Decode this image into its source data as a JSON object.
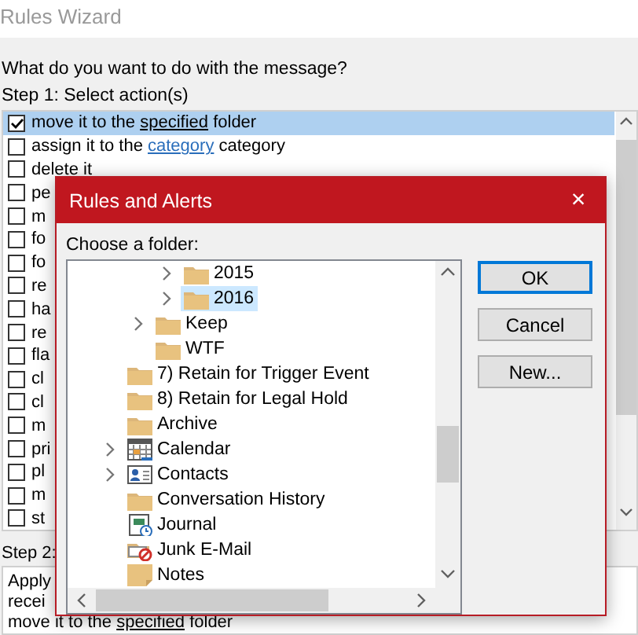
{
  "window": {
    "title": "Rules Wizard"
  },
  "question": "What do you want to do with the message?",
  "step1": {
    "label": "Step 1: Select action(s)",
    "actions": [
      {
        "checked": true,
        "selected": true,
        "parts": [
          {
            "kind": "text",
            "text": "move it to the "
          },
          {
            "kind": "link_set",
            "text": "specified"
          },
          {
            "kind": "text",
            "text": " folder"
          }
        ]
      },
      {
        "checked": false,
        "selected": false,
        "parts": [
          {
            "kind": "text",
            "text": "assign it to the "
          },
          {
            "kind": "link_unset",
            "text": "category"
          },
          {
            "kind": "text",
            "text": " category"
          }
        ]
      },
      {
        "checked": false,
        "selected": false,
        "parts": [
          {
            "kind": "text",
            "text": "delete it"
          }
        ]
      },
      {
        "checked": false,
        "selected": false,
        "parts": [
          {
            "kind": "text",
            "text": "pe"
          }
        ]
      },
      {
        "checked": false,
        "selected": false,
        "parts": [
          {
            "kind": "text",
            "text": "m"
          }
        ]
      },
      {
        "checked": false,
        "selected": false,
        "parts": [
          {
            "kind": "text",
            "text": "fo"
          }
        ]
      },
      {
        "checked": false,
        "selected": false,
        "parts": [
          {
            "kind": "text",
            "text": "fo"
          }
        ]
      },
      {
        "checked": false,
        "selected": false,
        "parts": [
          {
            "kind": "text",
            "text": "re"
          }
        ]
      },
      {
        "checked": false,
        "selected": false,
        "parts": [
          {
            "kind": "text",
            "text": "ha"
          }
        ]
      },
      {
        "checked": false,
        "selected": false,
        "parts": [
          {
            "kind": "text",
            "text": "re"
          }
        ]
      },
      {
        "checked": false,
        "selected": false,
        "parts": [
          {
            "kind": "text",
            "text": "fla"
          }
        ]
      },
      {
        "checked": false,
        "selected": false,
        "parts": [
          {
            "kind": "text",
            "text": "cl"
          }
        ]
      },
      {
        "checked": false,
        "selected": false,
        "parts": [
          {
            "kind": "text",
            "text": "cl"
          }
        ]
      },
      {
        "checked": false,
        "selected": false,
        "parts": [
          {
            "kind": "text",
            "text": "m"
          }
        ]
      },
      {
        "checked": false,
        "selected": false,
        "parts": [
          {
            "kind": "text",
            "text": "pri"
          }
        ]
      },
      {
        "checked": false,
        "selected": false,
        "parts": [
          {
            "kind": "text",
            "text": "pl"
          }
        ]
      },
      {
        "checked": false,
        "selected": false,
        "parts": [
          {
            "kind": "text",
            "text": "m"
          }
        ]
      },
      {
        "checked": false,
        "selected": false,
        "parts": [
          {
            "kind": "text",
            "text": "st"
          }
        ]
      }
    ]
  },
  "step2": {
    "label": "Step 2:",
    "lines": [
      [
        {
          "kind": "text",
          "text": "Apply"
        }
      ],
      [
        {
          "kind": "text",
          "text": "recei"
        }
      ],
      [
        {
          "kind": "text",
          "text": "move it to the "
        },
        {
          "kind": "link_set",
          "text": "specified"
        },
        {
          "kind": "text",
          "text": " folder"
        }
      ]
    ]
  },
  "dialog": {
    "title": "Rules and Alerts",
    "close": "×",
    "prompt": "Choose a folder:",
    "tree": [
      {
        "children": [
          {
            "children": [
              {
                "label": "2015",
                "kind": "folder",
                "expandable": true,
                "selected": false
              },
              {
                "label": "2016",
                "kind": "folder",
                "expandable": true,
                "selected": true
              }
            ]
          },
          {
            "label": "Keep",
            "kind": "folder",
            "expandable": true,
            "selected": false
          },
          {
            "label": "WTF",
            "kind": "folder",
            "expandable": false,
            "selected": false
          }
        ]
      },
      {
        "label": "7) Retain for Trigger Event",
        "kind": "folder",
        "expandable": false,
        "selected": false
      },
      {
        "label": "8) Retain for Legal Hold",
        "kind": "folder",
        "expandable": false,
        "selected": false
      },
      {
        "label": "Archive",
        "kind": "folder",
        "expandable": false,
        "selected": false
      },
      {
        "label": "Calendar",
        "kind": "calendar",
        "expandable": true,
        "selected": false
      },
      {
        "label": "Contacts",
        "kind": "contacts",
        "expandable": true,
        "selected": false
      },
      {
        "label": "Conversation History",
        "kind": "folder",
        "expandable": false,
        "selected": false
      },
      {
        "label": "Journal",
        "kind": "journal",
        "expandable": false,
        "selected": false
      },
      {
        "label": "Junk E-Mail",
        "kind": "junk",
        "expandable": false,
        "selected": false
      },
      {
        "label": "Notes",
        "kind": "notes",
        "expandable": false,
        "selected": false
      }
    ],
    "buttons": [
      {
        "label": "OK",
        "default": true
      },
      {
        "label": "Cancel",
        "default": false
      },
      {
        "label": "New...",
        "default": false
      }
    ]
  }
}
